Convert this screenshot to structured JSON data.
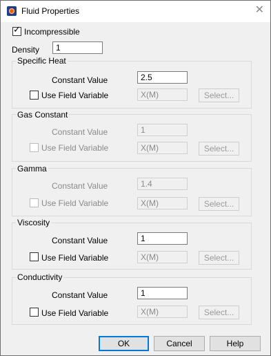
{
  "window": {
    "title": "Fluid Properties",
    "close_glyph": "✕",
    "icon": "app-logo-icon"
  },
  "incompressible": {
    "label": "Incompressible",
    "checked": true
  },
  "density": {
    "label": "Density",
    "value": "1"
  },
  "groups": [
    {
      "title": "Specific Heat",
      "enabled": true,
      "constant_label": "Constant Value",
      "constant_value": "2.5",
      "field_var_label": "Use Field Variable",
      "field_var_value": "X(M)",
      "select_label": "Select..."
    },
    {
      "title": "Gas Constant",
      "enabled": false,
      "constant_label": "Constant Value",
      "constant_value": "1",
      "field_var_label": "Use Field Variable",
      "field_var_value": "X(M)",
      "select_label": "Select..."
    },
    {
      "title": "Gamma",
      "enabled": false,
      "constant_label": "Constant Value",
      "constant_value": "1.4",
      "field_var_label": "Use Field Variable",
      "field_var_value": "X(M)",
      "select_label": "Select..."
    },
    {
      "title": "Viscosity",
      "enabled": true,
      "constant_label": "Constant Value",
      "constant_value": "1",
      "field_var_label": "Use Field Variable",
      "field_var_value": "X(M)",
      "select_label": "Select..."
    },
    {
      "title": "Conductivity",
      "enabled": true,
      "constant_label": "Constant Value",
      "constant_value": "1",
      "field_var_label": "Use Field Variable",
      "field_var_value": "X(M)",
      "select_label": "Select..."
    }
  ],
  "buttons": {
    "ok": "OK",
    "cancel": "Cancel",
    "help": "Help"
  }
}
